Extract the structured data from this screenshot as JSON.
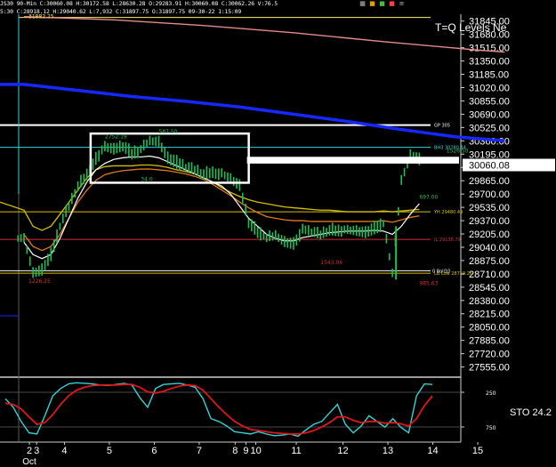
{
  "header": {
    "line1": "JS30  90-Min  C:30060.08  H:30172.58  L:28630.28  O:29283.91  H:30060.08  C:30062.26  V:76.5",
    "line2": "5:30  C:28918.12  H:29040.62  L:7,932  C:31897.75  O:31897.75  09-30-22  1:15:09"
  },
  "title_right": "T=Q Levels Ne",
  "oscillator_label": "STO  24.2",
  "top_icons": [
    {
      "name": "grid-icon",
      "glyph": "▦",
      "color": "#c0c0c0"
    },
    {
      "name": "lock-icon",
      "glyph": "■",
      "color": "#e0a000"
    },
    {
      "name": "color-icon",
      "glyph": "■",
      "color": "#40c040"
    },
    {
      "name": "flag-icon",
      "glyph": "■",
      "color": "#ff4040"
    },
    {
      "name": "menu-icon",
      "glyph": "≡",
      "color": "#c0c0c0"
    }
  ],
  "colors": {
    "background": "#000000",
    "price": "#1bbf5a",
    "ma_white": "#ffffff",
    "ma_yellow": "#d6c000",
    "ma_orange": "#e07a1e",
    "ma_blue": "#1428ff",
    "ma_pink": "#e88a8a",
    "cyan": "#35d2d8",
    "stoch_k": "#35d2d8",
    "stoch_d": "#e01818",
    "level_red": "#d43030",
    "box": "#ffffff"
  },
  "chart_data": [
    {
      "type": "line",
      "ylim": [
        27440,
        31930
      ],
      "yticks": [
        "31845.00",
        "31680.00",
        "31515.00",
        "31350.00",
        "31185.00",
        "31020.00",
        "30855.00",
        "30690.00",
        "30525.00",
        "30360.00",
        "30195.00",
        "30030.00",
        "29865.00",
        "29700.00",
        "29535.00",
        "29370.00",
        "29205.00",
        "29040.00",
        "28875.00",
        "28710.00",
        "28545.00",
        "28380.00",
        "28215.00",
        "28050.00",
        "27885.00",
        "27720.00",
        "27555.00"
      ],
      "last_price": "30060.08",
      "xticks": [
        {
          "label": "2",
          "bar": 0.6
        },
        {
          "label": "3",
          "bar": 1.4
        },
        {
          "label": "4",
          "bar": 4.5
        },
        {
          "label": "5",
          "bar": 9.5
        },
        {
          "label": "6",
          "bar": 14.5
        },
        {
          "label": "7",
          "bar": 19.5
        },
        {
          "label": "8",
          "bar": 23.5
        },
        {
          "label": "9",
          "bar": 24.7
        },
        {
          "label": "10",
          "bar": 25.8
        },
        {
          "label": "11",
          "bar": 30.3
        },
        {
          "label": "12",
          "bar": 35.5
        },
        {
          "label": "13",
          "bar": 40.5
        },
        {
          "label": "14",
          "bar": 45.5
        },
        {
          "label": "15",
          "bar": 50.5
        }
      ],
      "xlabel_month": "Oct",
      "price_series": [
        29150,
        28720,
        28760,
        28950,
        29300,
        29550,
        29800,
        29950,
        30150,
        30280,
        30250,
        30300,
        30210,
        30250,
        30360,
        30350,
        30150,
        30100,
        30030,
        30000,
        29950,
        29980,
        29950,
        29880,
        29800,
        29350,
        29240,
        29150,
        29190,
        29110,
        29090,
        29250,
        29230,
        29200,
        29260,
        29260,
        29250,
        29240,
        29220,
        29280,
        29330,
        28720,
        29880,
        30190,
        30140
      ],
      "ma_white": [
        29100,
        28950,
        28900,
        28950,
        29150,
        29400,
        29650,
        29850,
        30000,
        30080,
        30130,
        30150,
        30160,
        30160,
        30170,
        30150,
        30100,
        30050,
        30000,
        29950,
        29900,
        29850,
        29800,
        29700,
        29550,
        29400,
        29300,
        29200,
        29150,
        29120,
        29120,
        29160,
        29180,
        29200,
        29220,
        29230,
        29240,
        29240,
        29240,
        29250,
        29240,
        29200,
        29300,
        29450,
        29580
      ],
      "ma_yellow": [
        29500,
        29300,
        29250,
        29300,
        29450,
        29600,
        29750,
        29900,
        30000,
        30040,
        30050,
        30050,
        30050,
        30060,
        30060,
        30050,
        30030,
        30000,
        29980,
        29950,
        29900,
        29850,
        29780,
        29720,
        29670,
        29630,
        29600,
        29580,
        29560,
        29540,
        29530,
        29520,
        29510,
        29500,
        29500,
        29490,
        29480,
        29480,
        29480,
        29480,
        29490,
        29480,
        29490,
        29500,
        29510
      ],
      "ma_orange": [
        29200,
        29050,
        29000,
        29050,
        29200,
        29400,
        29600,
        29750,
        29870,
        29940,
        29970,
        29990,
        30000,
        30010,
        30010,
        30000,
        29990,
        29970,
        29950,
        29920,
        29880,
        29820,
        29750,
        29680,
        29600,
        29530,
        29470,
        29420,
        29400,
        29380,
        29370,
        29370,
        29360,
        29360,
        29360,
        29360,
        29360,
        29360,
        29360,
        29360,
        29370,
        29350,
        29380,
        29410,
        29430
      ],
      "ma_blue": [
        [
          0,
          31060
        ],
        [
          6,
          30985
        ],
        [
          12,
          30910
        ],
        [
          18,
          30850
        ],
        [
          24,
          30780
        ],
        [
          30,
          30690
        ],
        [
          36,
          30600
        ],
        [
          42,
          30500
        ],
        [
          48,
          30410
        ],
        [
          53.5,
          30360
        ]
      ],
      "ma_pink": [
        [
          0,
          31900
        ],
        [
          10,
          31860
        ],
        [
          20,
          31790
        ],
        [
          30,
          31700
        ],
        [
          40,
          31590
        ],
        [
          50,
          31490
        ],
        [
          53.5,
          31460
        ]
      ],
      "levels": [
        {
          "label": "",
          "value": 31890,
          "color": "#ffee66"
        },
        {
          "label": "GP 305",
          "value": 30555,
          "color": "#ffffff"
        },
        {
          "label": "BH3 30280.44",
          "value": 30280,
          "color": "#35d2d8"
        },
        {
          "label": "YH 29480.49",
          "value": 29480,
          "color": "#d6c000"
        },
        {
          "label": "IL 29138.79",
          "value": 29138,
          "color": "#d43030"
        },
        {
          "label": "LB Low 28719.26",
          "value": 28719,
          "color": "#d6c000"
        },
        {
          "label": "0 Roll10",
          "value": 28748,
          "color": "#ffffff"
        }
      ],
      "annotations": [
        {
          "label": "31882.25",
          "bar": 0.5,
          "value": 31880,
          "color": "#ffee66"
        },
        {
          "label": "2752.19",
          "bar": 9.0,
          "value": 30390,
          "color": "#1bbf5a"
        },
        {
          "label": "587.50",
          "bar": 15.0,
          "value": 30450,
          "color": "#1bbf5a"
        },
        {
          "label": "1526.50",
          "bar": 47.0,
          "value": 30215,
          "color": "#1bbf5a"
        },
        {
          "label": "697.00",
          "bar": 44.0,
          "value": 29640,
          "color": "#1bbf5a"
        },
        {
          "label": "1226.25",
          "bar": 0.5,
          "value": 28600,
          "color": "#d43030"
        },
        {
          "label": "1543.06",
          "bar": 33.0,
          "value": 28830,
          "color": "#d43030"
        },
        {
          "label": "985.63",
          "bar": 44.0,
          "value": 28570,
          "color": "#d43030"
        },
        {
          "label": "34.0",
          "bar": 13.0,
          "value": 29860,
          "color": "#1bbf5a"
        }
      ],
      "boxes": [
        {
          "bar_from": 8.8,
          "bar_to": 26.4,
          "top": 30450,
          "bottom": 29840
        },
        {
          "bar_from": 26.4,
          "bar_to": 49.6,
          "top": 30140,
          "bottom": 30100
        }
      ]
    },
    {
      "type": "line",
      "title": "STO",
      "ylim": [
        0,
        100
      ],
      "yticks": [
        "250",
        "750"
      ],
      "series": [
        {
          "values": [
            70,
            55,
            30,
            10,
            8,
            40,
            75,
            88,
            96,
            98,
            97,
            96,
            94,
            93,
            95,
            97,
            94,
            72,
            55,
            88,
            95,
            96,
            97,
            94,
            90,
            70,
            35,
            30,
            22,
            12,
            10,
            8,
            12,
            8,
            5,
            6,
            8,
            4,
            15,
            25,
            30,
            45,
            60,
            25,
            10,
            22,
            40,
            30,
            20,
            35,
            20,
            10,
            75,
            96,
            95
          ]
        },
        {
          "values": [
            62,
            60,
            52,
            38,
            25,
            28,
            42,
            60,
            75,
            85,
            90,
            93,
            94,
            94,
            94,
            95,
            95,
            90,
            82,
            80,
            83,
            88,
            92,
            94,
            93,
            85,
            70,
            55,
            42,
            30,
            22,
            16,
            14,
            12,
            10,
            9,
            8,
            8,
            10,
            14,
            20,
            28,
            38,
            38,
            32,
            28,
            30,
            30,
            27,
            28,
            26,
            22,
            35,
            58,
            75
          ]
        }
      ]
    }
  ]
}
